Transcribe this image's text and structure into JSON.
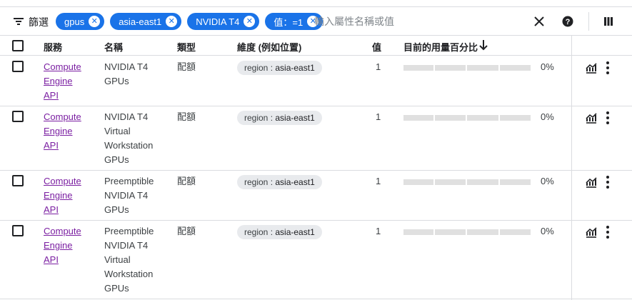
{
  "filter": {
    "label": "篩選",
    "chips": [
      "gpus",
      "asia-east1",
      "NVIDIA T4",
      "值：=1"
    ],
    "placeholder": "輸入屬性名稱或值"
  },
  "columns": {
    "service": "服務",
    "name": "名稱",
    "type": "類型",
    "dimension": "維度 (例如位置)",
    "value": "值",
    "usage": "目前的用量百分比"
  },
  "rows": [
    {
      "service": [
        "Compute",
        "Engine",
        "API"
      ],
      "name": [
        "NVIDIA T4",
        "GPUs"
      ],
      "type": "配額",
      "dim_key": "region",
      "dim_val": "asia-east1",
      "value": "1",
      "usage_fraction": 0,
      "usage_label": "0%"
    },
    {
      "service": [
        "Compute",
        "Engine",
        "API"
      ],
      "name": [
        "NVIDIA T4",
        "Virtual",
        "Workstation",
        "GPUs"
      ],
      "type": "配額",
      "dim_key": "region",
      "dim_val": "asia-east1",
      "value": "1",
      "usage_fraction": 0,
      "usage_label": "0%"
    },
    {
      "service": [
        "Compute",
        "Engine",
        "API"
      ],
      "name": [
        "Preemptible",
        "NVIDIA T4",
        "GPUs"
      ],
      "type": "配額",
      "dim_key": "region",
      "dim_val": "asia-east1",
      "value": "1",
      "usage_fraction": 0,
      "usage_label": "0%"
    },
    {
      "service": [
        "Compute",
        "Engine",
        "API"
      ],
      "name": [
        "Preemptible",
        "NVIDIA T4",
        "Virtual",
        "Workstation",
        "GPUs"
      ],
      "type": "配額",
      "dim_key": "region",
      "dim_val": "asia-east1",
      "value": "1",
      "usage_fraction": 0,
      "usage_label": "0%"
    }
  ],
  "colors": {
    "chip": "#1a73e8",
    "link": "#7b1fa2",
    "bar_track": "#e0e0e0"
  },
  "icons": [
    "filter-icon",
    "close-icon",
    "help-icon",
    "column-display-icon",
    "arrow-down-icon",
    "chart-icon",
    "more-vert-icon"
  ]
}
